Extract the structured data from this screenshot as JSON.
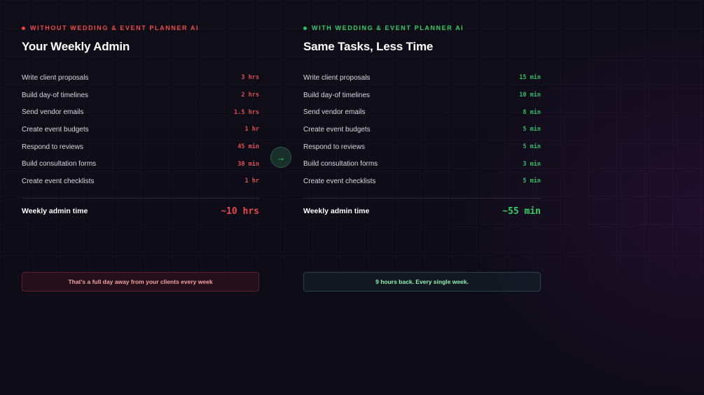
{
  "left": {
    "eyebrow": "WITHOUT WEDDING & EVENT PLANNER AI",
    "title": "Your Weekly Admin",
    "rows": [
      {
        "task": "Write client proposals",
        "time": "3 hrs"
      },
      {
        "task": "Build day-of timelines",
        "time": "2 hrs"
      },
      {
        "task": "Send vendor emails",
        "time": "1.5 hrs"
      },
      {
        "task": "Create event budgets",
        "time": "1 hr"
      },
      {
        "task": "Respond to reviews",
        "time": "45 min"
      },
      {
        "task": "Build consultation forms",
        "time": "30 min"
      },
      {
        "task": "Create event checklists",
        "time": "1 hr"
      }
    ],
    "total_label": "Weekly admin time",
    "total_value": "~10 hrs",
    "note": "That's a full day away from your clients every week"
  },
  "right": {
    "eyebrow": "WITH WEDDING & EVENT PLANNER AI",
    "title": "Same Tasks, Less Time",
    "rows": [
      {
        "task": "Write client proposals",
        "time": "15 min"
      },
      {
        "task": "Build day-of timelines",
        "time": "10 min"
      },
      {
        "task": "Send vendor emails",
        "time": "8 min"
      },
      {
        "task": "Create event budgets",
        "time": "5 min"
      },
      {
        "task": "Respond to reviews",
        "time": "5 min"
      },
      {
        "task": "Build consultation forms",
        "time": "3 min"
      },
      {
        "task": "Create event checklists",
        "time": "5 min"
      }
    ],
    "total_label": "Weekly admin time",
    "total_value": "~55 min",
    "note": "9 hours back. Every single week."
  },
  "arrow": {
    "icon": "arrow-right-icon",
    "glyph": "→"
  },
  "colors": {
    "without_accent": "#ef4444",
    "with_accent": "#22c55e",
    "background": "#0d0c16"
  }
}
